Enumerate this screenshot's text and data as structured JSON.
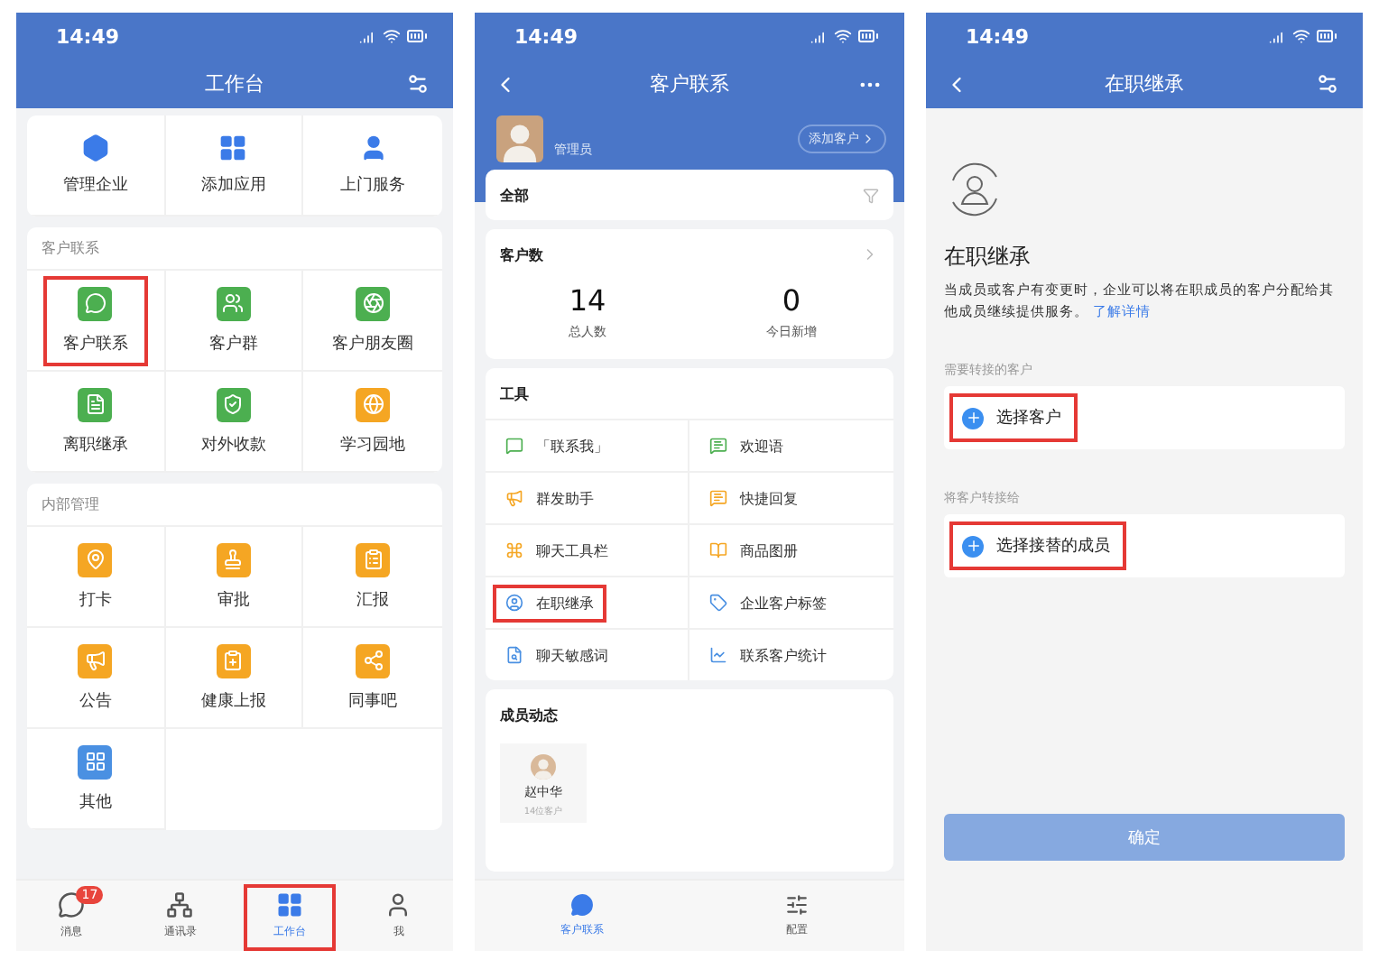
{
  "workbench": {
    "time": "14:49",
    "title": "工作台",
    "top_apps": [
      {
        "label": "管理企业"
      },
      {
        "label": "添加应用"
      },
      {
        "label": "上门服务"
      }
    ],
    "sections": [
      {
        "heading": "客户联系",
        "items": [
          {
            "label": "客户联系",
            "color": "#4caf50",
            "highlighted": true
          },
          {
            "label": "客户群",
            "color": "#4caf50",
            "highlighted": false
          },
          {
            "label": "客户朋友圈",
            "color": "#4caf50",
            "highlighted": false
          },
          {
            "label": "离职继承",
            "color": "#4caf50",
            "highlighted": false
          },
          {
            "label": "对外收款",
            "color": "#4caf50",
            "highlighted": false
          },
          {
            "label": "学习园地",
            "color": "#f5a623",
            "highlighted": false
          }
        ]
      },
      {
        "heading": "内部管理",
        "items": [
          {
            "label": "打卡",
            "color": "#f5a623",
            "highlighted": false
          },
          {
            "label": "审批",
            "color": "#f5a623",
            "highlighted": false
          },
          {
            "label": "汇报",
            "color": "#f5a623",
            "highlighted": false
          },
          {
            "label": "公告",
            "color": "#f5a623",
            "highlighted": false
          },
          {
            "label": "健康上报",
            "color": "#f5a623",
            "highlighted": false
          },
          {
            "label": "同事吧",
            "color": "#f5a623",
            "highlighted": false
          },
          {
            "label": "其他",
            "color": "#4a90e2",
            "highlighted": false
          }
        ]
      }
    ],
    "tabs": [
      {
        "label": "消息",
        "badge": "17",
        "selected": false,
        "highlighted": false
      },
      {
        "label": "通讯录",
        "selected": false,
        "highlighted": false
      },
      {
        "label": "工作台",
        "selected": true,
        "highlighted": true
      },
      {
        "label": "我",
        "selected": false,
        "highlighted": false
      }
    ]
  },
  "customer_contact": {
    "time": "14:49",
    "title": "客户联系",
    "role": "管理员",
    "add_button": "添加客户",
    "filter": "全部",
    "stats_title": "客户数",
    "stats": [
      {
        "value": "14",
        "label": "总人数"
      },
      {
        "value": "0",
        "label": "今日新增"
      }
    ],
    "tools_title": "工具",
    "tools": [
      {
        "label": "「联系我」",
        "highlighted": false
      },
      {
        "label": "欢迎语",
        "highlighted": false
      },
      {
        "label": "群发助手",
        "highlighted": false
      },
      {
        "label": "快捷回复",
        "highlighted": false
      },
      {
        "label": "聊天工具栏",
        "highlighted": false
      },
      {
        "label": "商品图册",
        "highlighted": false
      },
      {
        "label": "在职继承",
        "highlighted": true
      },
      {
        "label": "企业客户标签",
        "highlighted": false
      },
      {
        "label": "聊天敏感词",
        "highlighted": false
      },
      {
        "label": "联系客户统计",
        "highlighted": false
      }
    ],
    "members_title": "成员动态",
    "members": [
      {
        "name": "赵中华",
        "detail": "14位客户"
      }
    ],
    "tabs": [
      {
        "label": "客户联系",
        "selected": true
      },
      {
        "label": "配置",
        "selected": false
      }
    ]
  },
  "succession": {
    "time": "14:49",
    "title": "在职继承",
    "heading": "在职继承",
    "description": "当成员或客户有变更时，企业可以将在职成员的客户分配给其他成员继续提供服务。",
    "link": "了解详情",
    "fields": [
      {
        "label": "需要转接的客户",
        "action": "选择客户",
        "highlighted": true
      },
      {
        "label": "将客户转接给",
        "action": "选择接替的成员",
        "highlighted": true
      }
    ],
    "confirm": {
      "label": "确定",
      "disabled": true
    }
  }
}
